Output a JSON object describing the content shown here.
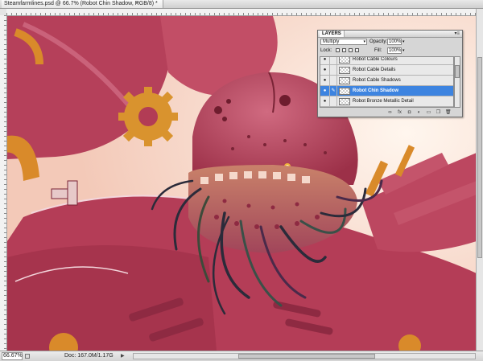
{
  "document": {
    "tab_title": "Steamfarmlines.psd @ 66.7% (Robot Chin Shadow, RGB/8) *",
    "close_glyph": "×"
  },
  "status": {
    "zoom": "66.67%",
    "doc_info": "Doc: 167.0M/1.17G",
    "arrow_glyph": "▶"
  },
  "layers_panel": {
    "tab_label": "LAYERS",
    "menu_glyph": "▾≡",
    "blend_mode": "Multiply",
    "opacity_label": "Opacity:",
    "opacity_value": "100%",
    "lock_label": "Lock:",
    "fill_label": "Fill:",
    "fill_value": "100%",
    "dropdown_glyph": "▾",
    "eye_glyph": "●",
    "brush_glyph": "✎",
    "layers": [
      {
        "name": "Robot Cable Colours",
        "selected": false
      },
      {
        "name": "Robot Cable Details",
        "selected": false
      },
      {
        "name": "Robot Cable Shadows",
        "selected": false
      },
      {
        "name": "Robot Chin Shadow",
        "selected": true
      },
      {
        "name": "Robot Bronze Metallic Detail",
        "selected": false
      }
    ],
    "footer_icons": [
      "link-icon",
      "fx-icon",
      "mask-icon",
      "adjustment-icon",
      "folder-icon",
      "new-layer-icon",
      "trash-icon"
    ],
    "footer_glyphs": [
      "∞",
      "fx",
      "◘",
      "◐",
      "▭",
      "❐",
      "🗑"
    ]
  },
  "colors": {
    "robot_main": "#b8405a",
    "robot_dark": "#7a2436",
    "robot_light": "#d9748a",
    "brass": "#d98a2a",
    "background": "#fbe6d8",
    "selection_blue": "#3d84e0"
  }
}
